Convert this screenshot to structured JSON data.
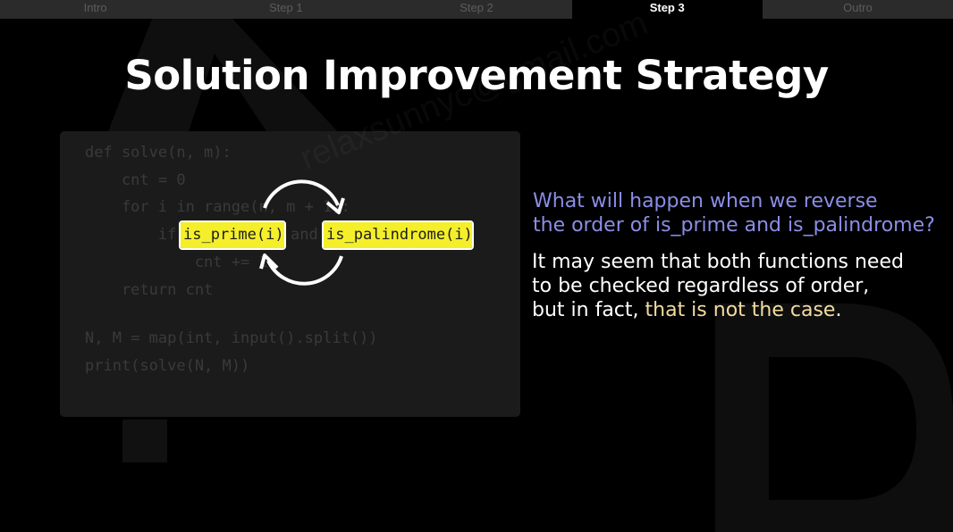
{
  "tabs": [
    {
      "label": "Intro",
      "active": false
    },
    {
      "label": "Step 1",
      "active": false
    },
    {
      "label": "Step 2",
      "active": false
    },
    {
      "label": "Step 3",
      "active": true
    },
    {
      "label": "Outro",
      "active": false
    }
  ],
  "title": "Solution Improvement Strategy",
  "code": {
    "lines": [
      "def solve(n, m):",
      "    cnt = 0",
      "    for i in range(n, m + 1):",
      "        if",
      "            cnt += 1",
      "    return cnt",
      "N, M = map(int, input().split())",
      "print(solve(N, M))"
    ],
    "and_word": "and",
    "func_prime": "is_prime(i)",
    "func_palindrome": "is_palindrome(i)"
  },
  "watermark": "relaxsunnyc@gmail.com",
  "question": {
    "line1": "What will happen when we reverse",
    "line2": "the order of is_prime and is_palindrome?"
  },
  "answer": {
    "line1": "It may seem that both functions need",
    "line2": "to be checked regardless of order,",
    "line3_prefix": "but in fact, ",
    "line3_highlight": "that is not the case",
    "line3_suffix": "."
  },
  "colors": {
    "question": "#8b8ee6",
    "highlight": "#f4dca0",
    "func_box": "#f4ef2a",
    "active_tab_bg": "#000000",
    "inactive_tab_bg": "#2b2b2b"
  }
}
